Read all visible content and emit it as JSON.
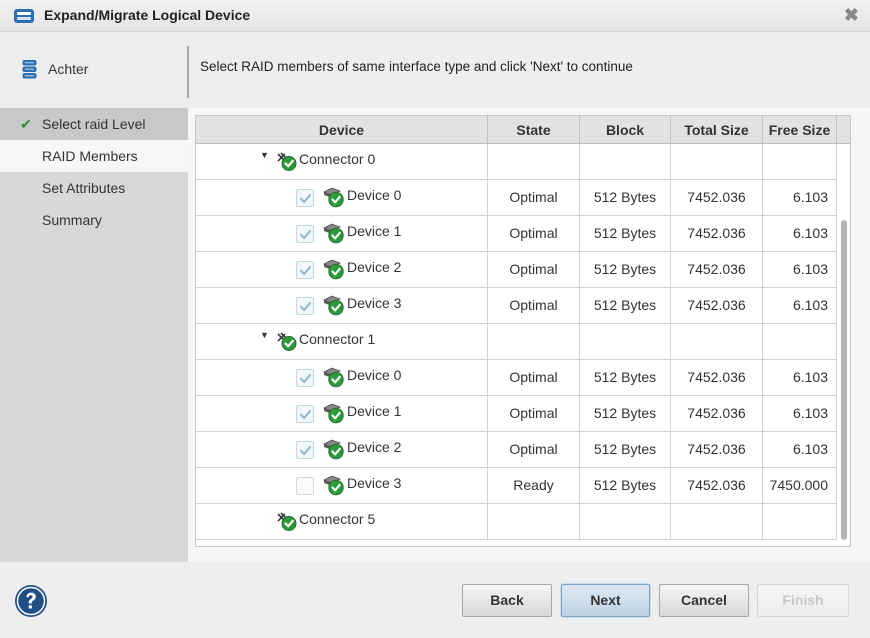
{
  "window": {
    "title": "Expand/Migrate Logical Device",
    "close_glyph": "✖"
  },
  "header": {
    "back_label": "Achter",
    "instruction": "Select RAID members of same interface type and click 'Next' to continue"
  },
  "steps": [
    {
      "label": "Select raid Level",
      "status": "done"
    },
    {
      "label": "RAID Members",
      "status": "active"
    },
    {
      "label": "Set Attributes",
      "status": "pending"
    },
    {
      "label": "Summary",
      "status": "pending"
    }
  ],
  "table": {
    "columns": [
      "Device",
      "State",
      "Block",
      "Total Size",
      "Free Size"
    ],
    "rows": [
      {
        "type": "connector",
        "label": "Connector 0",
        "expanded": true
      },
      {
        "type": "device",
        "label": "Device 0",
        "checked": true,
        "state": "Optimal",
        "block": "512 Bytes",
        "total": "7452.036",
        "free": "6.103"
      },
      {
        "type": "device",
        "label": "Device 1",
        "checked": true,
        "state": "Optimal",
        "block": "512 Bytes",
        "total": "7452.036",
        "free": "6.103"
      },
      {
        "type": "device",
        "label": "Device 2",
        "checked": true,
        "state": "Optimal",
        "block": "512 Bytes",
        "total": "7452.036",
        "free": "6.103"
      },
      {
        "type": "device",
        "label": "Device 3",
        "checked": true,
        "state": "Optimal",
        "block": "512 Bytes",
        "total": "7452.036",
        "free": "6.103"
      },
      {
        "type": "connector",
        "label": "Connector 1",
        "expanded": true
      },
      {
        "type": "device",
        "label": "Device 0",
        "checked": true,
        "state": "Optimal",
        "block": "512 Bytes",
        "total": "7452.036",
        "free": "6.103"
      },
      {
        "type": "device",
        "label": "Device 1",
        "checked": true,
        "state": "Optimal",
        "block": "512 Bytes",
        "total": "7452.036",
        "free": "6.103"
      },
      {
        "type": "device",
        "label": "Device 2",
        "checked": true,
        "state": "Optimal",
        "block": "512 Bytes",
        "total": "7452.036",
        "free": "6.103"
      },
      {
        "type": "device",
        "label": "Device 3",
        "checked": false,
        "state": "Ready",
        "block": "512 Bytes",
        "total": "7452.036",
        "free": "7450.000"
      },
      {
        "type": "connector",
        "label": "Connector 5",
        "expanded": false,
        "no_expander": true
      }
    ]
  },
  "buttons": {
    "back": "Back",
    "next": "Next",
    "cancel": "Cancel",
    "finish": "Finish"
  },
  "icons": {
    "title": "raid-controller-icon",
    "back": "database-icon",
    "help": "help-icon",
    "connector": "connector-ok-icon",
    "device": "disk-ok-icon"
  },
  "colors": {
    "ok_green": "#2e9b3a",
    "help_blue": "#1f4f86",
    "check_green": "#2e8b2e"
  }
}
